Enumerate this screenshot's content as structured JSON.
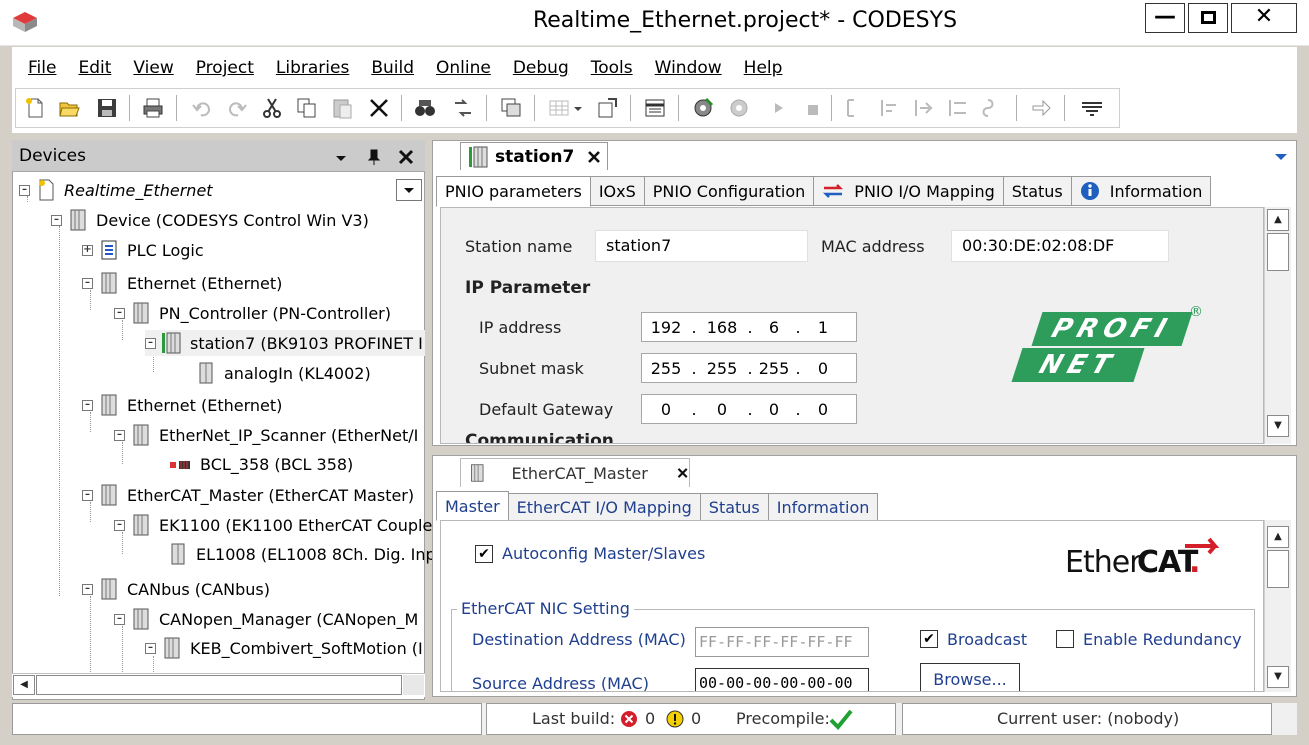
{
  "window": {
    "title": "Realtime_Ethernet.project* - CODESYS"
  },
  "menu": [
    "File",
    "Edit",
    "View",
    "Project",
    "Libraries",
    "Build",
    "Online",
    "Debug",
    "Tools",
    "Window",
    "Help"
  ],
  "devices": {
    "title": "Devices",
    "tree": [
      {
        "label": "Realtime_Ethernet",
        "italic": true
      },
      {
        "label": "Device (CODESYS Control Win V3)"
      },
      {
        "label": "PLC Logic"
      },
      {
        "label": "Ethernet (Ethernet)"
      },
      {
        "label": "PN_Controller (PN-Controller)"
      },
      {
        "label": "station7 (BK9103 PROFINET I"
      },
      {
        "label": "analogIn (KL4002)"
      },
      {
        "label": "Ethernet (Ethernet)"
      },
      {
        "label": "EtherNet_IP_Scanner (EtherNet/I"
      },
      {
        "label": "BCL_358 (BCL 358)"
      },
      {
        "label": "EtherCAT_Master (EtherCAT Master)"
      },
      {
        "label": "EK1100 (EK1100 EtherCAT Couple"
      },
      {
        "label": "EL1008 (EL1008 8Ch. Dig. Inp"
      },
      {
        "label": "CANbus (CANbus)"
      },
      {
        "label": "CANopen_Manager (CANopen_M"
      },
      {
        "label": "KEB_Combivert_SoftMotion (I"
      }
    ]
  },
  "editor_top": {
    "doc_tab": "station7",
    "tabs": [
      "PNIO parameters",
      "IOxS",
      "PNIO Configuration",
      "PNIO I/O Mapping",
      "Status",
      "Information"
    ],
    "station_name_label": "Station name",
    "station_name": "station7",
    "mac_label": "MAC address",
    "mac": "00:30:DE:02:08:DF",
    "ip_section": "IP Parameter",
    "ip_address_label": "IP address",
    "ip_address": [
      "192",
      "168",
      "6",
      "1"
    ],
    "subnet_label": "Subnet mask",
    "subnet": [
      "255",
      "255",
      "255",
      "0"
    ],
    "gateway_label": "Default Gateway",
    "gateway": [
      "0",
      "0",
      "0",
      "0"
    ],
    "comm_section": "Communication",
    "logo_top": "PROFI",
    "logo_bottom": "NET",
    "logo_mark": "®"
  },
  "editor_bottom": {
    "doc_tab": "EtherCAT_Master",
    "tabs": [
      "Master",
      "EtherCAT I/O Mapping",
      "Status",
      "Information"
    ],
    "autoconfig_label": "Autoconfig Master/Slaves",
    "autoconfig_checked": "✔",
    "logo_text_a": "Ether",
    "logo_text_b": "CAT",
    "logo_mark": ".",
    "nic_group": "EtherCAT NIC Setting",
    "dest_label": "Destination Address (MAC)",
    "dest_value": "FF-FF-FF-FF-FF-FF",
    "broadcast_label": "Broadcast",
    "broadcast_checked": "✔",
    "redundancy_label": "Enable Redundancy",
    "source_label": "Source Address (MAC)",
    "source_value": "00-00-00-00-00-00",
    "browse_label": "Browse..."
  },
  "status": {
    "last_build_label": "Last build:",
    "errors": "0",
    "warnings": "0",
    "precompile_label": "Precompile:",
    "current_user": "Current user: (nobody)"
  },
  "colors": {
    "profinet_green": "#2e9c5a",
    "ethercat_red": "#d41f2a",
    "info_blue": "#1f5fbf",
    "checkmark_green": "#21a034"
  }
}
